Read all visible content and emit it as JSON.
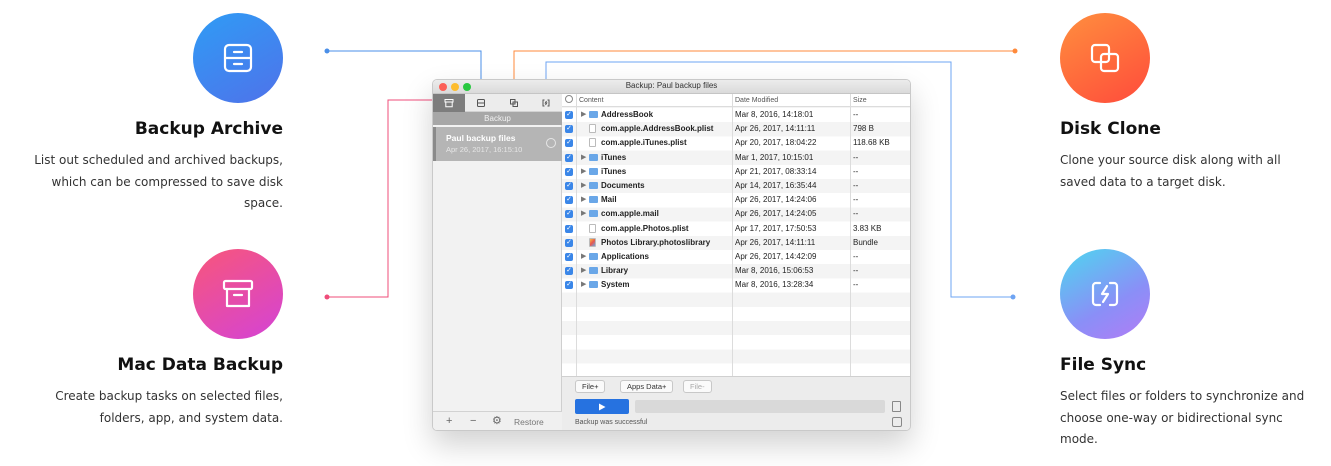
{
  "features": {
    "archive": {
      "title": "Backup Archive",
      "desc": "List out scheduled and archived backups, which can be compressed to save disk space.",
      "icon": "archive-tray-icon",
      "color": "#4a79ec"
    },
    "backup": {
      "title": "Mac Data Backup",
      "desc": "Create backup tasks on selected files, folders, app, and system data.",
      "icon": "archive-box-icon",
      "color": "#e8479f"
    },
    "clone": {
      "title": "Disk Clone",
      "desc": "Clone your source disk along with all saved data to a target disk.",
      "icon": "clone-icon",
      "color": "#ff6b3b"
    },
    "sync": {
      "title": "File Sync",
      "desc": "Select files or folders to synchronize and choose one-way or bidirectional sync mode.",
      "icon": "sync-icon",
      "color": "#8a8ff7"
    }
  },
  "window": {
    "title": "Backup: Paul backup files",
    "sidebar": {
      "header": "Backup",
      "item_name": "Paul backup files",
      "item_date": "Apr 26, 2017, 16:15:10",
      "restore": "Restore",
      "plus": "+",
      "minus": "−",
      "gear": "⚙"
    },
    "columns": {
      "content": "Content",
      "date": "Date Modified",
      "size": "Size"
    },
    "rows": [
      {
        "name": "AddressBook",
        "date": "Mar 8, 2016, 14:18:01",
        "size": "--",
        "type": "folder"
      },
      {
        "name": "com.apple.AddressBook.plist",
        "date": "Apr 26, 2017, 14:11:11",
        "size": "798 B",
        "type": "file"
      },
      {
        "name": "com.apple.iTunes.plist",
        "date": "Apr 20, 2017, 18:04:22",
        "size": "118.68 KB",
        "type": "file"
      },
      {
        "name": "iTunes",
        "date": "Mar 1, 2017, 10:15:01",
        "size": "--",
        "type": "folder"
      },
      {
        "name": "iTunes",
        "date": "Apr 21, 2017, 08:33:14",
        "size": "--",
        "type": "folder"
      },
      {
        "name": "Documents",
        "date": "Apr 14, 2017, 16:35:44",
        "size": "--",
        "type": "folder"
      },
      {
        "name": "Mail",
        "date": "Apr 26, 2017, 14:24:06",
        "size": "--",
        "type": "folder"
      },
      {
        "name": "com.apple.mail",
        "date": "Apr 26, 2017, 14:24:05",
        "size": "--",
        "type": "folder"
      },
      {
        "name": "com.apple.Photos.plist",
        "date": "Apr 17, 2017, 17:50:53",
        "size": "3.83 KB",
        "type": "file"
      },
      {
        "name": "Photos Library.photoslibrary",
        "date": "Apr 26, 2017, 14:11:11",
        "size": "Bundle",
        "type": "lib"
      },
      {
        "name": "Applications",
        "date": "Apr 26, 2017, 14:42:09",
        "size": "--",
        "type": "folder"
      },
      {
        "name": "Library",
        "date": "Mar 8, 2016, 15:06:53",
        "size": "--",
        "type": "folder"
      },
      {
        "name": "System",
        "date": "Mar 8, 2016, 13:28:34",
        "size": "--",
        "type": "folder"
      }
    ],
    "buttons": {
      "file_plus": "File+",
      "apps_data_plus": "Apps Data+",
      "file_minus": "File-"
    },
    "status": "Backup was successful"
  }
}
